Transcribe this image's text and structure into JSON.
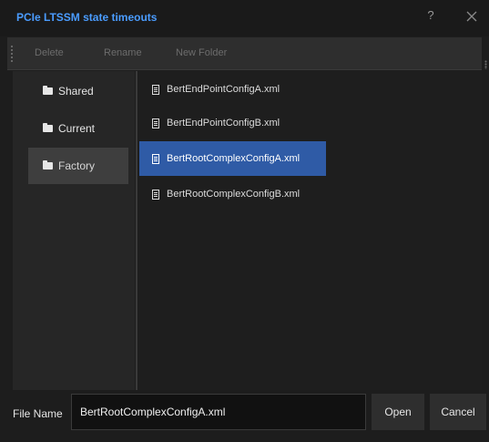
{
  "window": {
    "title": "PCIe LTSSM state timeouts",
    "help": "?"
  },
  "toolbar": {
    "delete_label": "Delete",
    "rename_label": "Rename",
    "new_folder_label": "New Folder"
  },
  "sidebar": {
    "items": [
      {
        "label": "Shared",
        "icon": "folder-icon"
      },
      {
        "label": "Current",
        "icon": "folder-icon"
      },
      {
        "label": "Factory",
        "icon": "folder-icon",
        "selected": true
      }
    ]
  },
  "files": {
    "items": [
      {
        "name": "BertEndPointConfigA.xml",
        "icon": "file-icon"
      },
      {
        "name": "BertEndPointConfigB.xml",
        "icon": "file-icon"
      },
      {
        "name": "BertRootComplexConfigA.xml",
        "icon": "file-icon",
        "selected": true
      },
      {
        "name": "BertRootComplexConfigB.xml",
        "icon": "file-icon"
      }
    ]
  },
  "footer": {
    "filename_label": "File Name",
    "filename_value": "BertRootComplexConfigA.xml",
    "open_label": "Open",
    "cancel_label": "Cancel"
  },
  "colors": {
    "accent": "#4a9cff",
    "selection": "#2f5ba6",
    "background": "#1d1d1d"
  }
}
